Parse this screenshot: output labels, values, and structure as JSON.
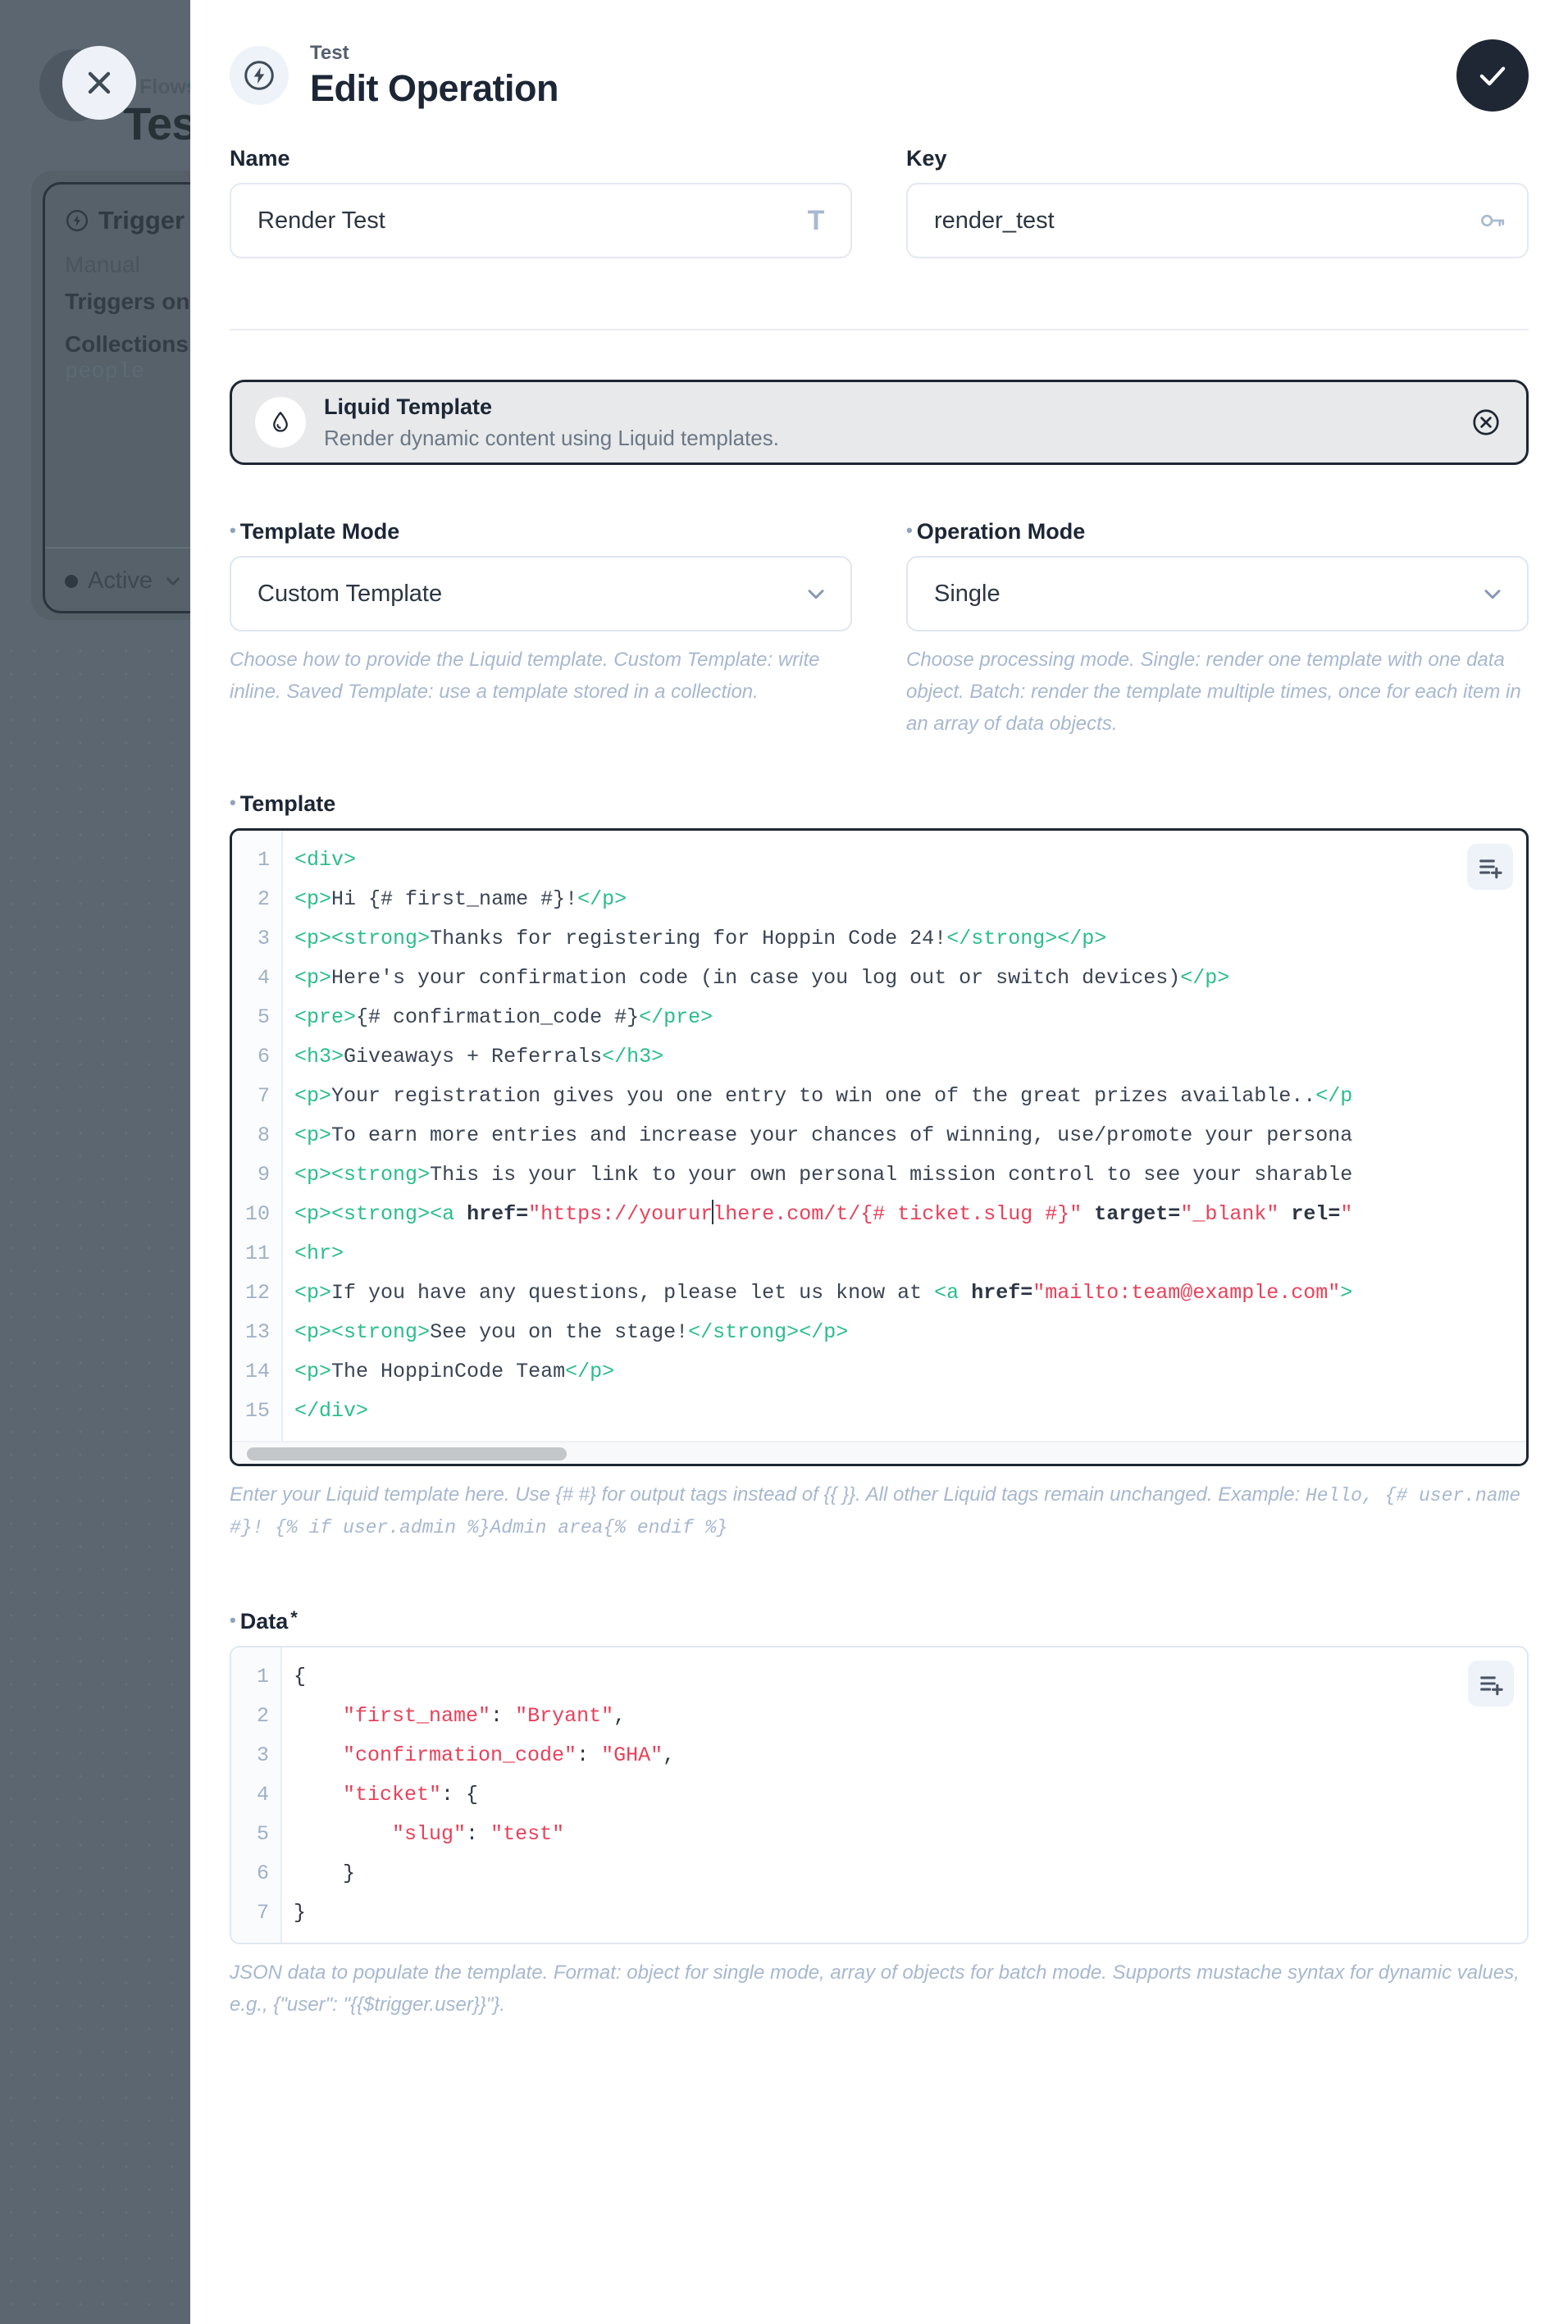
{
  "background": {
    "breadcrumb": "Flows",
    "flow_title": "Test",
    "close_label": "close-icon",
    "card": {
      "title": "Trigger",
      "type_label": "Manual",
      "description": "Triggers on selected c",
      "collections_label": "Collections",
      "collection_value": "people",
      "status": "Active"
    }
  },
  "header": {
    "eyebrow": "Test",
    "title": "Edit Operation",
    "confirm_label": "check-icon"
  },
  "form": {
    "name": {
      "label": "Name",
      "value": "Render Test",
      "placeholder": "Name",
      "icon": "text-icon"
    },
    "key": {
      "label": "Key",
      "value": "render_test",
      "placeholder": "Key",
      "icon": "key-icon"
    }
  },
  "operation_card": {
    "title": "Liquid Template",
    "description": "Render dynamic content using Liquid templates.",
    "icon": "droplet-icon",
    "clear_icon": "circle-x-icon"
  },
  "template_mode": {
    "label": "Template Mode",
    "value": "Custom Template",
    "options": [
      "Custom Template",
      "Saved Template"
    ],
    "help": "Choose how to provide the Liquid template. Custom Template: write inline. Saved Template: use a template stored in a collection."
  },
  "operation_mode": {
    "label": "Operation Mode",
    "value": "Single",
    "options": [
      "Single",
      "Batch"
    ],
    "help": "Choose processing mode. Single: render one template with one data object. Batch: render the template multiple times, once for each item in an array of data objects."
  },
  "template_editor": {
    "label": "Template",
    "action_icon": "list-plus-icon",
    "line_numbers": [
      "1",
      "2",
      "3",
      "4",
      "5",
      "6",
      "7",
      "8",
      "9",
      "10",
      "11",
      "12",
      "13",
      "14",
      "15"
    ],
    "lines": [
      "<div>",
      "<p>Hi {# first_name #}!</p>",
      "<p><strong>Thanks for registering for Hoppin Code 24!</strong></p>",
      "<p>Here's your confirmation code (in case you log out or switch devices)</p>",
      "<pre>{# confirmation_code #}</pre>",
      "<h3>Giveaways + Referrals</h3>",
      "<p>Your registration gives you one entry to win one of the great prizes available..</p",
      "<p>To earn more entries and increase your chances of winning, use/promote your persona",
      "<p><strong>This is your link to your own personal mission control to see your sharable",
      "<p><strong><a href=\"https://yoururlhere.com/t/{# ticket.slug #}\" target=\"_blank\" rel=\"",
      "<hr>",
      "<p>If you have any questions, please let us know at <a href=\"mailto:team@example.com\">",
      "<p><strong>See you on the stage!</strong></p>",
      "<p>The HoppinCode Team</p>",
      "</div>"
    ],
    "help_plain_1": "Enter your Liquid template here. Use {# #} for output tags instead of {{ }}. All other Liquid tags remain unchanged. Example: ",
    "help_mono": "Hello, {# user.name #}! {% if user.admin %}Admin area{% endif %}"
  },
  "data_editor": {
    "label": "Data",
    "required_marker": "*",
    "action_icon": "list-plus-icon",
    "line_numbers": [
      "1",
      "2",
      "3",
      "4",
      "5",
      "6",
      "7"
    ],
    "lines": [
      "{",
      "    \"first_name\": \"Bryant\",",
      "    \"confirmation_code\": \"GHA\",",
      "    \"ticket\": {",
      "        \"slug\": \"test\"",
      "    }",
      "}"
    ],
    "help": "JSON data to populate the template. Format: object for single mode, array of objects for batch mode. Supports mustache syntax for dynamic values, e.g., {\"user\": \"{{$trigger.user}}\"}."
  },
  "colors": {
    "accent_dark": "#1e2733",
    "muted_text": "#a7b8d0",
    "code_tag": "#2bbd8c",
    "code_string": "#e8415a",
    "panel_bg": "#ffffff",
    "backdrop": "#5c6670"
  }
}
